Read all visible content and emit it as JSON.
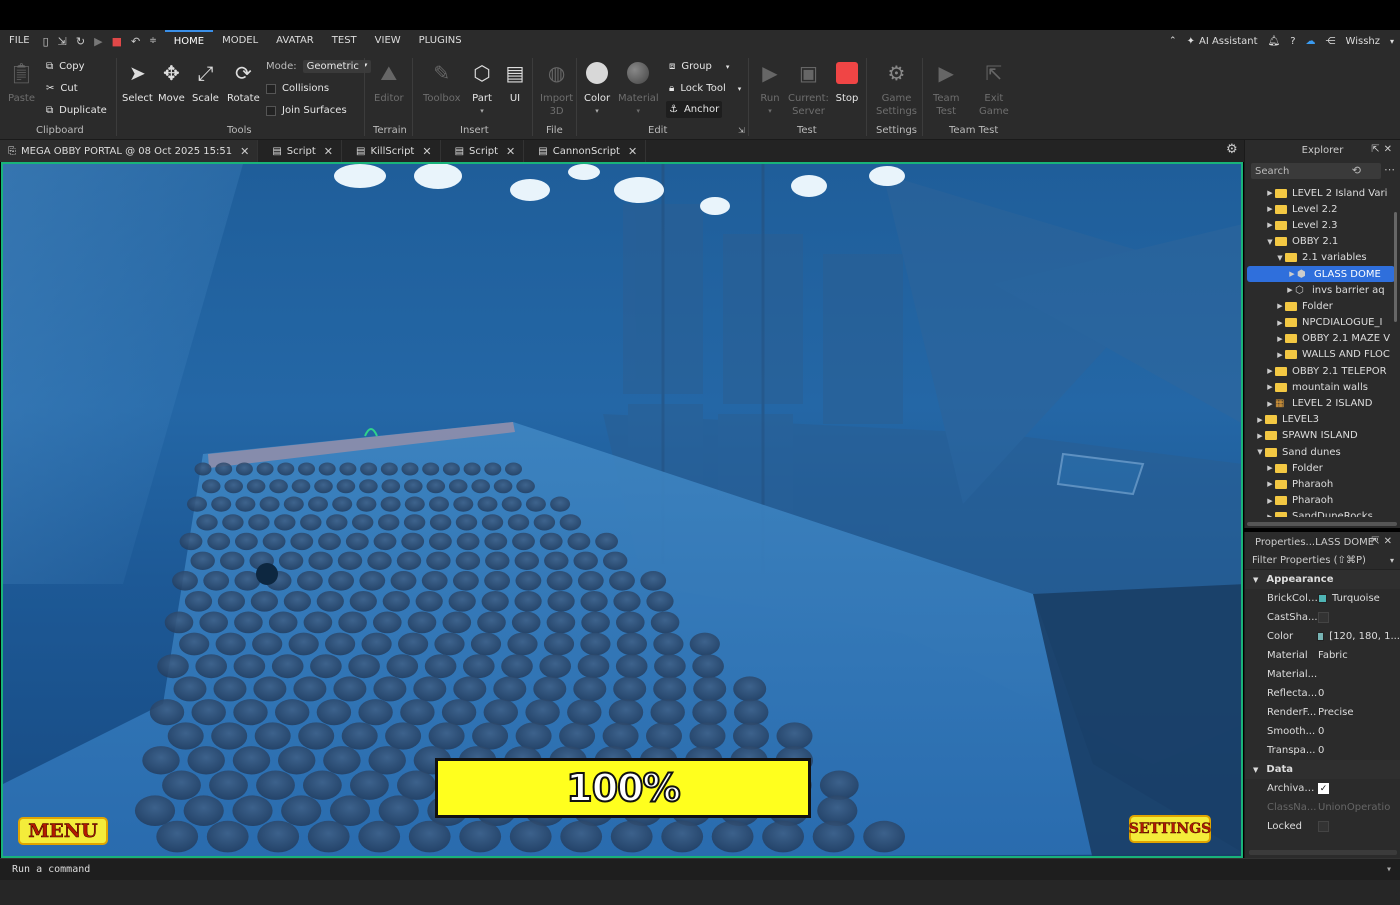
{
  "menubar": {
    "file": "FILE",
    "tabs": [
      "HOME",
      "MODEL",
      "AVATAR",
      "TEST",
      "VIEW",
      "PLUGINS"
    ],
    "active_tab": "HOME",
    "ai_assistant": "AI Assistant",
    "user": "Wisshz"
  },
  "ribbon": {
    "paste": "Paste",
    "copy": "Copy",
    "cut": "Cut",
    "duplicate": "Duplicate",
    "clipboard": "Clipboard",
    "select": "Select",
    "move": "Move",
    "scale": "Scale",
    "rotate": "Rotate",
    "mode_label": "Mode:",
    "mode_value": "Geometric",
    "collisions": "Collisions",
    "join_surfaces": "Join Surfaces",
    "tools": "Tools",
    "editor": "Editor",
    "terrain": "Terrain",
    "toolbox": "Toolbox",
    "part": "Part",
    "ui": "UI",
    "insert": "Insert",
    "import3d_1": "Import",
    "import3d_2": "3D",
    "file": "File",
    "color": "Color",
    "material": "Material",
    "group": "Group",
    "lock_tool": "Lock Tool",
    "anchor": "Anchor",
    "edit": "Edit",
    "run": "Run",
    "current_server_1": "Current:",
    "current_server_2": "Server",
    "stop": "Stop",
    "test": "Test",
    "game_settings_1": "Game",
    "game_settings_2": "Settings",
    "settings": "Settings",
    "team_test_1": "Team",
    "team_test_2": "Test",
    "exit_game_1": "Exit",
    "exit_game_2": "Game",
    "team_test_group": "Team Test"
  },
  "tabs": [
    {
      "label": "MEGA OBBY PORTAL @ 08 Oct 2025 15:51",
      "icon": "place-icon"
    },
    {
      "label": "Script",
      "icon": "script-icon"
    },
    {
      "label": "KillScript",
      "icon": "script-icon"
    },
    {
      "label": "Script",
      "icon": "script-icon"
    },
    {
      "label": "CannonScript",
      "icon": "script-icon"
    }
  ],
  "hud": {
    "progress": "100%",
    "menu": "MENU",
    "settings": "SETTINGS"
  },
  "command_bar": {
    "placeholder": "Run a command"
  },
  "explorer": {
    "title": "Explorer",
    "search_placeholder": "Search",
    "items": [
      {
        "label": "LEVEL 2 Island Vari",
        "indent": 2,
        "icon": "folder",
        "expanded": false
      },
      {
        "label": "Level 2.2",
        "indent": 2,
        "icon": "folder",
        "expanded": false
      },
      {
        "label": "Level 2.3",
        "indent": 2,
        "icon": "folder",
        "expanded": false
      },
      {
        "label": "OBBY 2.1",
        "indent": 2,
        "icon": "folder",
        "expanded": true
      },
      {
        "label": "2.1 variables",
        "indent": 3,
        "icon": "folder",
        "expanded": true
      },
      {
        "label": "GLASS DOME",
        "indent": 4,
        "icon": "union",
        "expanded": false,
        "selected": true
      },
      {
        "label": "invs barrier aq",
        "indent": 4,
        "icon": "part",
        "expanded": false
      },
      {
        "label": "Folder",
        "indent": 3,
        "icon": "folder",
        "expanded": false
      },
      {
        "label": "NPCDIALOGUE_I",
        "indent": 3,
        "icon": "folder",
        "expanded": false
      },
      {
        "label": "OBBY 2.1 MAZE V",
        "indent": 3,
        "icon": "folder",
        "expanded": false
      },
      {
        "label": "WALLS AND FLOC",
        "indent": 3,
        "icon": "folder",
        "expanded": false
      },
      {
        "label": "OBBY 2.1 TELEPOR",
        "indent": 2,
        "icon": "folder",
        "expanded": false
      },
      {
        "label": "mountain walls",
        "indent": 2,
        "icon": "folder",
        "expanded": false
      },
      {
        "label": "LEVEL 2 ISLAND",
        "indent": 2,
        "icon": "model",
        "expanded": false
      },
      {
        "label": "LEVEL3",
        "indent": 1,
        "icon": "folder",
        "expanded": false
      },
      {
        "label": "SPAWN ISLAND",
        "indent": 1,
        "icon": "folder",
        "expanded": false
      },
      {
        "label": "Sand dunes",
        "indent": 1,
        "icon": "folder",
        "expanded": true
      },
      {
        "label": "Folder",
        "indent": 2,
        "icon": "folder",
        "expanded": false
      },
      {
        "label": "Pharaoh",
        "indent": 2,
        "icon": "folder",
        "expanded": false
      },
      {
        "label": "Pharaoh",
        "indent": 2,
        "icon": "folder",
        "expanded": false
      },
      {
        "label": "SandDuneRocks",
        "indent": 2,
        "icon": "folder",
        "expanded": false
      }
    ]
  },
  "properties": {
    "title": "Properties...LASS DOME\"",
    "filter": "Filter Properties (⇧⌘P)",
    "appearance": "Appearance",
    "data": "Data",
    "rows": [
      {
        "name": "BrickColor",
        "value": "Turquoise",
        "swatch": "#4fb4b4"
      },
      {
        "name": "CastSha...",
        "value": "",
        "checkbox": false
      },
      {
        "name": "Color",
        "value": "[120, 180, 1...",
        "swatch": "#78b4b4"
      },
      {
        "name": "Material",
        "value": "Fabric"
      },
      {
        "name": "Material...",
        "value": ""
      },
      {
        "name": "Reflecta...",
        "value": "0"
      },
      {
        "name": "RenderF...",
        "value": "Precise"
      },
      {
        "name": "Smooth...",
        "value": "0"
      },
      {
        "name": "Transpa...",
        "value": "0"
      }
    ],
    "data_rows": [
      {
        "name": "Archivable",
        "checkbox": true
      },
      {
        "name": "ClassNa...",
        "value": "UnionOperatio",
        "dim": true
      },
      {
        "name": "Locked",
        "checkbox": false
      }
    ]
  }
}
